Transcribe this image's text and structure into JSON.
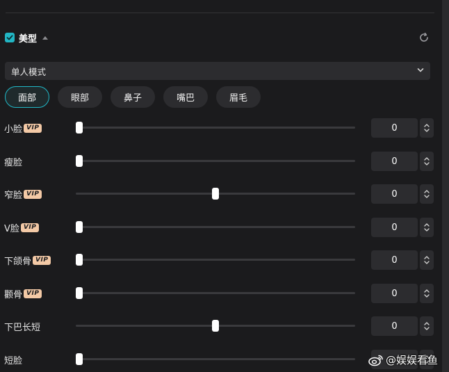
{
  "panel": {
    "title": "美型",
    "checked": true,
    "accent_color": "#20b9c8",
    "vip_color": "#f3c9a6"
  },
  "mode_select": {
    "value": "单人模式"
  },
  "tabs": [
    {
      "label": "面部",
      "active": true
    },
    {
      "label": "眼部",
      "active": false
    },
    {
      "label": "鼻子",
      "active": false
    },
    {
      "label": "嘴巴",
      "active": false
    },
    {
      "label": "眉毛",
      "active": false
    }
  ],
  "sliders": [
    {
      "label": "小脸",
      "vip": "VIP",
      "value": "0",
      "slider_position": 0.0
    },
    {
      "label": "瘦脸",
      "vip": "",
      "value": "0",
      "slider_position": 0.0
    },
    {
      "label": "窄脸",
      "vip": "VIP",
      "value": "0",
      "slider_position": 0.5
    },
    {
      "label": "V脸",
      "vip": "VIP",
      "value": "0",
      "slider_position": 0.0
    },
    {
      "label": "下颌骨",
      "vip": "VIP",
      "value": "0",
      "slider_position": 0.0
    },
    {
      "label": "颧骨",
      "vip": "VIP",
      "value": "0",
      "slider_position": 0.0
    },
    {
      "label": "下巴长短",
      "vip": "",
      "value": "0",
      "slider_position": 0.5
    },
    {
      "label": "短脸",
      "vip": "",
      "value": "",
      "slider_position": 0.0
    }
  ],
  "watermark": {
    "text": "@娱娱看鱼"
  },
  "icons": [
    "check-icon",
    "caret-up-icon",
    "reset-icon",
    "chevron-down-icon",
    "stepper-icon",
    "weibo-icon"
  ]
}
